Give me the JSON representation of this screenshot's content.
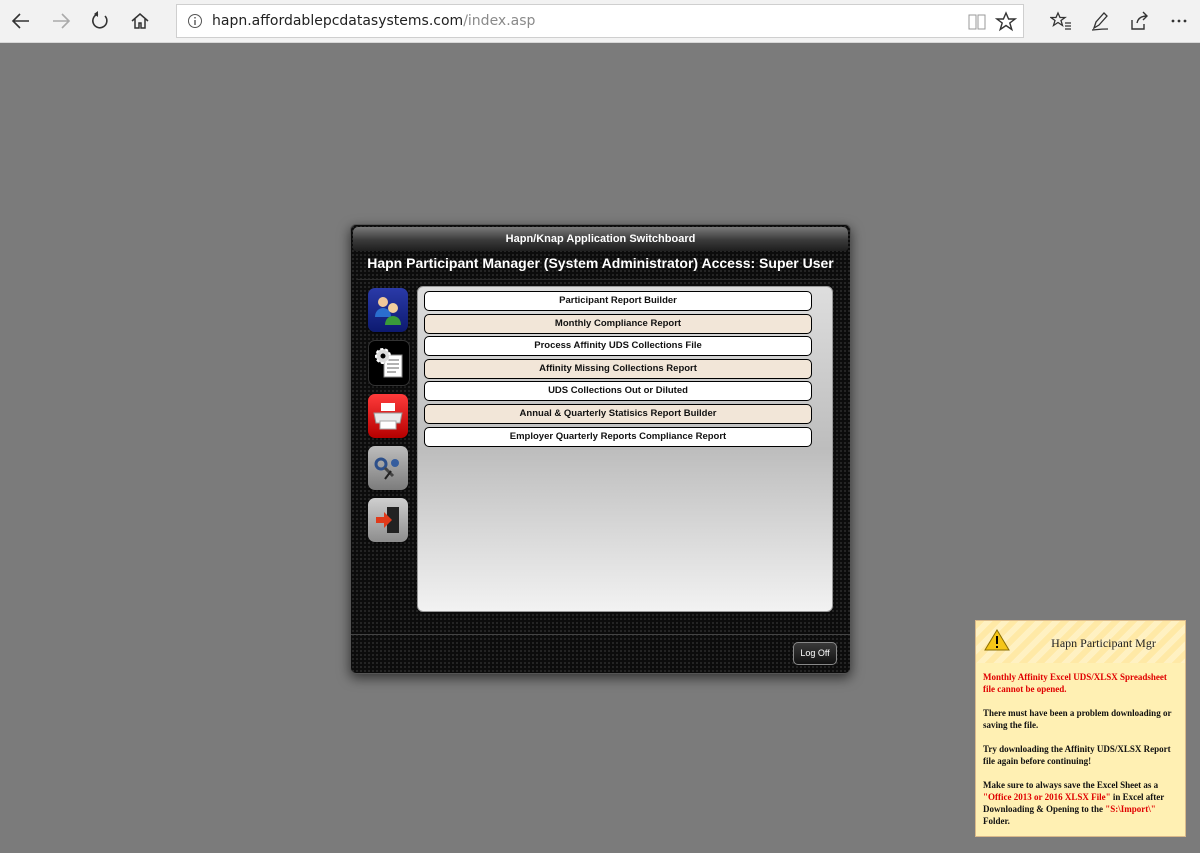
{
  "browser": {
    "url_host": "hapn.affordablepcdatasystems.com",
    "url_path": "/index.asp"
  },
  "switchboard": {
    "title": "Hapn/Knap Application Switchboard",
    "subtitle": "Hapn Participant Manager (System Administrator) Access: Super User",
    "side_icons": [
      "users-icon",
      "settings-document-icon",
      "printer-icon",
      "tools-icon",
      "exit-door-icon"
    ],
    "menu": [
      "Participant Report Builder",
      "Monthly Compliance Report",
      "Process Affinity UDS Collections File",
      "Affinity Missing Collections Report",
      "UDS Collections Out or Diluted",
      "Annual & Quarterly Statisics Report Builder",
      "Employer Quarterly Reports Compliance Report"
    ],
    "logoff_label": "Log Off"
  },
  "notification": {
    "title": "Hapn Participant Mgr",
    "error": "Monthly Affinity Excel UDS/XLSX Spreadsheet file cannot be opened.",
    "p1": "There must have been a problem downloading or saving the file.",
    "p2": "Try downloading the Affinity UDS/XLSX Report file again before continuing!",
    "p3_a": "Make sure to always save the Excel Sheet as a ",
    "p3_b": "\"Office 2013 or 2016 XLSX File\"",
    "p3_c": " in Excel after Downloading & Opening to the ",
    "p3_d": "\"S:\\Import\\\"",
    "p3_e": " Folder."
  },
  "colors": {
    "accent_red": "#e00000",
    "menu_even": "#f2e6d8",
    "toast_bg": "#fff0b3"
  }
}
